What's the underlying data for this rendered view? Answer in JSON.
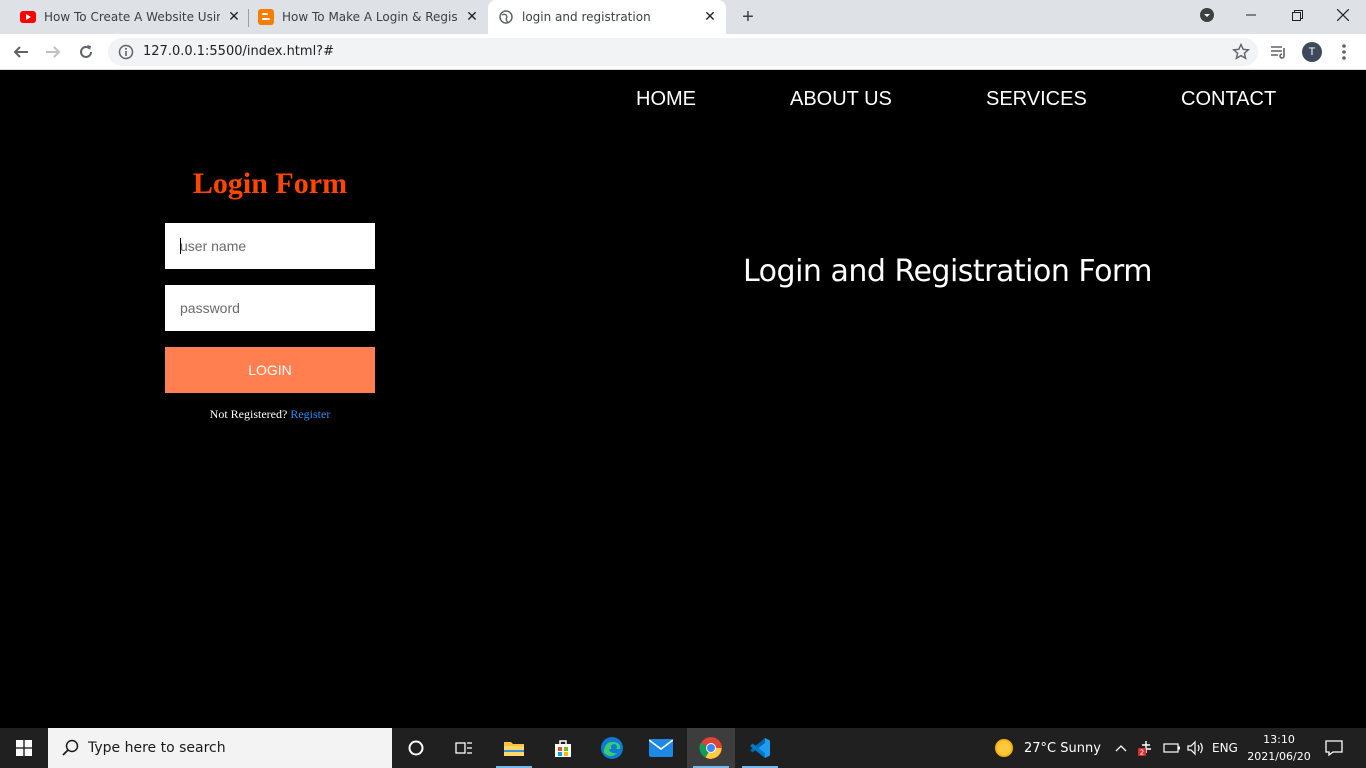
{
  "browser": {
    "tabs": [
      {
        "title": "How To Create A Website Using #",
        "favicon": "youtube-icon"
      },
      {
        "title": "How To Make A Login & Registra",
        "favicon": "blogger-icon"
      },
      {
        "title": "login and registration",
        "favicon": "globe-icon"
      }
    ],
    "url": "127.0.0.1:5500/index.html?#",
    "profile_initial": "T"
  },
  "page": {
    "nav": [
      "HOME",
      "ABOUT US",
      "SERVICES",
      "CONTACT"
    ],
    "form": {
      "title": "Login Form",
      "username_placeholder": "user name",
      "password_placeholder": "password",
      "login_label": "LOGIN",
      "not_registered": "Not Registered?",
      "register_link": "Register"
    },
    "hero_text": "Login and Registration Form",
    "colors": {
      "accent": "#ff4500",
      "button": "#ff7f50",
      "link": "#1e90ff",
      "background": "#000000"
    }
  },
  "taskbar": {
    "search_placeholder": "Type here to search",
    "weather": "27°C  Sunny",
    "language": "ENG",
    "time": "13:10",
    "date": "2021/06/20",
    "apps": [
      "cortana-icon",
      "task-view-icon",
      "file-explorer-icon",
      "store-icon",
      "edge-icon",
      "mail-icon",
      "chrome-icon",
      "vscode-icon"
    ]
  }
}
